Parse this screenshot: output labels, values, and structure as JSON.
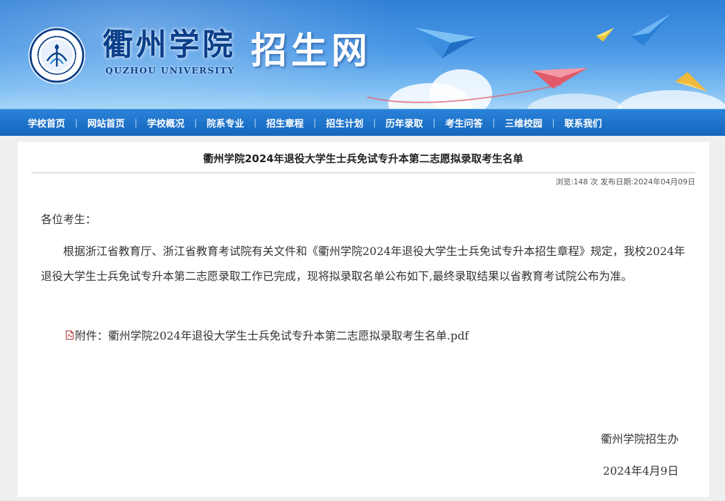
{
  "header": {
    "school_name": "衢州学院",
    "school_name_en": "QUZHOU UNIVERSITY",
    "site_title": "招生网",
    "colors": {
      "banner_top": "#2f7fd6",
      "nav": "#1566bd",
      "brand_text": "#0b3f8a"
    }
  },
  "nav": {
    "items": [
      {
        "label": "学校首页"
      },
      {
        "label": "网站首页"
      },
      {
        "label": "学校概况"
      },
      {
        "label": "院系专业"
      },
      {
        "label": "招生章程"
      },
      {
        "label": "招生计划"
      },
      {
        "label": "历年录取"
      },
      {
        "label": "考生问答"
      },
      {
        "label": "三维校园"
      },
      {
        "label": "联系我们"
      }
    ]
  },
  "article": {
    "title": "衢州学院2024年退役大学生士兵免试专升本第二志愿拟录取考生名单",
    "meta": "浏览:148 次 发布日期:2024年04月09日",
    "greeting": "各位考生：",
    "paragraph": "根据浙江省教育厅、浙江省教育考试院有关文件和《衢州学院2024年退役大学生士兵免试专升本招生章程》规定，我校2024年退役大学生士兵免试专升本第二志愿录取工作已完成，现将拟录取名单公布如下,最终录取结果以省教育考试院公布为准。",
    "attachment_prefix": "附件：",
    "attachment_name": "衢州学院2024年退役大学生士兵免试专升本第二志愿拟录取考生名单.pdf",
    "attachment_icon": "pdf-file-icon",
    "signature_org": "衢州学院招生办",
    "signature_date": "2024年4月9日"
  }
}
